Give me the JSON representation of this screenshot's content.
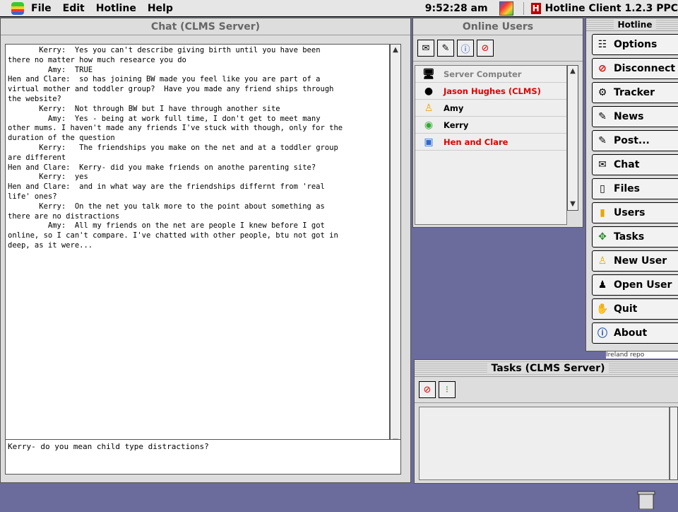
{
  "menubar": {
    "items": [
      "File",
      "Edit",
      "Hotline",
      "Help"
    ],
    "clock": "9:52:28 am",
    "app_name": "Hotline Client 1.2.3 PPC"
  },
  "chat": {
    "title": "Chat (CLMS Server)",
    "log": "       Kerry:  Yes you can't describe giving birth until you have been\nthere no matter how much researce you do\n         Amy:  TRUE\nHen and Clare:  so has joining BW made you feel like you are part of a\nvirtual mother and toddler group?  Have you made any friend ships through\nthe website?\n       Kerry:  Not through BW but I have through another site\n         Amy:  Yes - being at work full time, I don't get to meet many\nother mums. I haven't made any friends I've stuck with though, only for the\nduration of the question\n       Kerry:   The friendships you make on the net and at a toddler group\nare different\nHen and Clare:  Kerry- did you make friends on anothe parenting site?\n       Kerry:  yes\nHen and Clare:  and in what way are the friendships differnt from 'real\nlife' ones?\n       Kerry:  On the net you talk more to the point about something as\nthere are no distractions\n         Amy:  All my friends on the net are people I knew before I got\nonline, so I can't compare. I've chatted with other people, btu not got in\ndeep, as it were...",
    "input": "Kerry- do you mean child type distractions?"
  },
  "online_users": {
    "title": "Online Users",
    "users": [
      {
        "name": "Server Computer",
        "color": "#808080",
        "icon": "computer-icon"
      },
      {
        "name": "Jason Hughes (CLMS)",
        "color": "#e00000",
        "icon": "sphere-icon"
      },
      {
        "name": "Amy",
        "color": "#000000",
        "icon": "person-icon"
      },
      {
        "name": "Kerry",
        "color": "#000000",
        "icon": "ball-icon"
      },
      {
        "name": "Hen and Clare",
        "color": "#e00000",
        "icon": "picture-icon"
      }
    ]
  },
  "hotline": {
    "title": "Hotline",
    "buttons": [
      "Options",
      "Disconnect",
      "Tracker",
      "News",
      "Post...",
      "Chat",
      "Files",
      "Users",
      "Tasks",
      "New User",
      "Open User",
      "Quit",
      "About"
    ],
    "peek_text": "Ireland repo"
  },
  "tasks": {
    "title": "Tasks (CLMS Server)"
  }
}
